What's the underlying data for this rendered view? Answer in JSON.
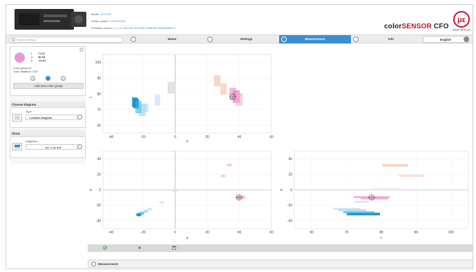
{
  "header": {
    "model_label": "Model:",
    "model_value": "CFO100",
    "serial_label": "Serial number:",
    "serial_value": "1404230784",
    "firmware_label": "Firmware version:",
    "firmware_value": "V 1.14 2019-06-28 15:30 (1058428 0x00AABBCC)",
    "brand_prefix": "color",
    "brand_mid": "SENSOR",
    "brand_suffix": " CFO",
    "logo_tagline": "MICRO-EPSILON"
  },
  "navbar": {
    "search_placeholder": "Search settings",
    "tabs": [
      {
        "label": "Home"
      },
      {
        "label": "Settings"
      },
      {
        "label": "Measurement"
      },
      {
        "label": "Info"
      }
    ],
    "language": "English"
  },
  "sidebar": {
    "color": {
      "swatch": "#e99bd0",
      "L_label": "L",
      "L_value": "77.37",
      "a_label": "a",
      "a_value": "36.08",
      "b_label": "b",
      "b_value": "-10.41",
      "group": "Color group #2",
      "distance": "Color distance: 3.05"
    },
    "pager": [
      "1",
      "2",
      "3"
    ],
    "add_button": "Add new color group",
    "diagram_section": "Choose diagram",
    "type_label": "Type",
    "type_value": "Location diagram",
    "show_section": "Show",
    "diagram_label": "Diagrams",
    "diagram_value": "a-L, L-b, a-b"
  },
  "chart_data": [
    {
      "type": "scatter",
      "title": "",
      "xlabel": "a",
      "ylabel": "L",
      "xlim": [
        -45,
        60
      ],
      "ylim": [
        55,
        105
      ],
      "xticks": [
        -40,
        -20,
        0,
        20,
        40,
        60
      ],
      "yticks": [
        60,
        70,
        80,
        90,
        100
      ],
      "marker": {
        "a": 37,
        "L": 77
      }
    },
    {
      "type": "scatter",
      "title": "",
      "xlabel": "a",
      "ylabel": "b",
      "xlim": [
        -45,
        60
      ],
      "ylim": [
        -50,
        50
      ],
      "xticks": [
        -40,
        -20,
        0,
        20,
        40,
        60
      ],
      "yticks": [
        -40,
        -20,
        0,
        20,
        40
      ],
      "marker": {
        "a": 37,
        "b": -11
      }
    },
    {
      "type": "scatter",
      "title": "",
      "xlabel": "L",
      "ylabel": "b",
      "xlim": [
        55,
        105
      ],
      "ylim": [
        -50,
        50
      ],
      "xticks": [
        60,
        70,
        80,
        90,
        100
      ],
      "yticks": [
        -40,
        -20,
        0,
        20,
        40
      ],
      "marker": {
        "L": 77,
        "b": -11
      }
    }
  ],
  "colors": {
    "accent": "#3a8fd1",
    "cyan": "#1aa0d4",
    "pink": "#e78fc6",
    "orange": "#f0b48c"
  }
}
